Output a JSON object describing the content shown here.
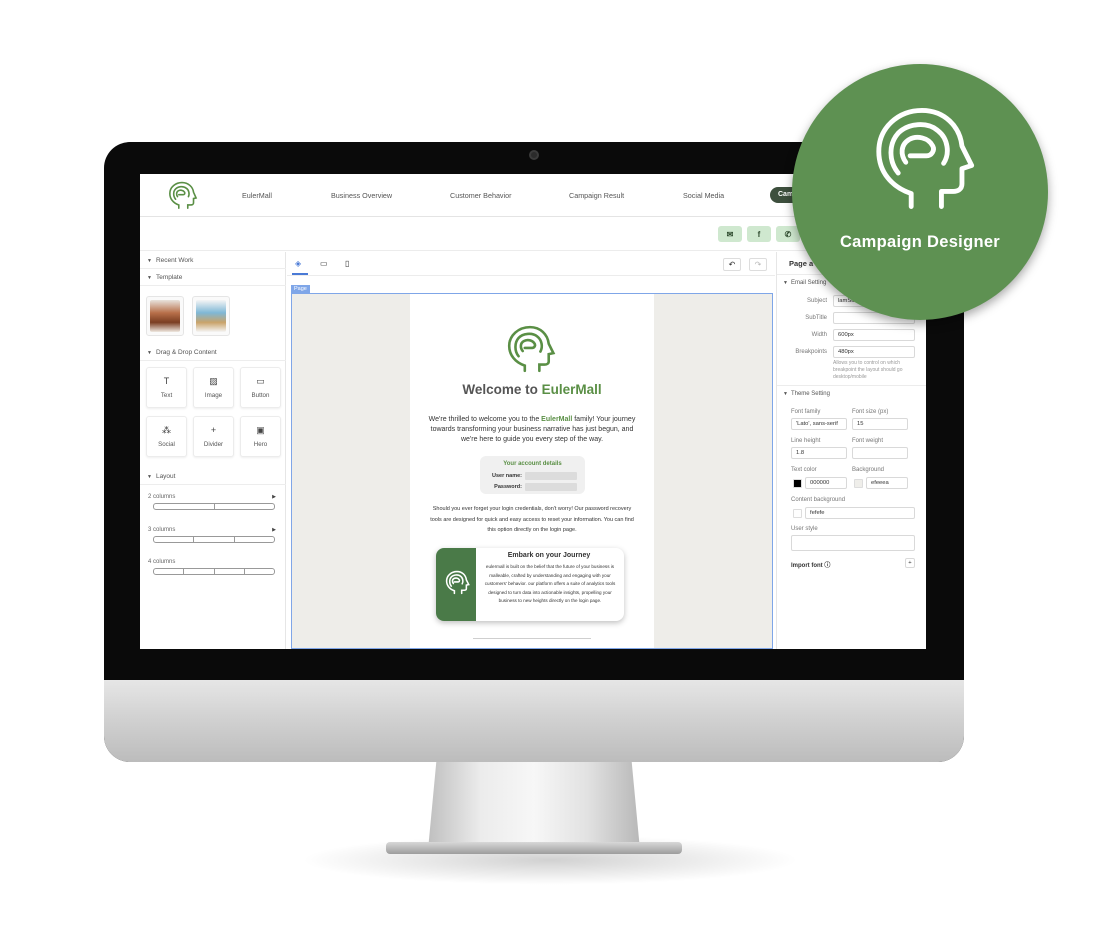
{
  "badge": {
    "label": "Campaign Designer"
  },
  "nav": {
    "items": [
      "EulerMall",
      "Business Overview",
      "Customer Behavior",
      "Campaign Result",
      "Social Media"
    ],
    "active_label": "Cam"
  },
  "share_buttons": [
    "mail-icon",
    "facebook-icon",
    "whatsapp-icon"
  ],
  "left_panel": {
    "recent_work": "Recent Work",
    "template": "Template",
    "drag_drop": "Drag & Drop Content",
    "tools": [
      {
        "label": "Text",
        "icon": "text-icon"
      },
      {
        "label": "Image",
        "icon": "image-icon"
      },
      {
        "label": "Button",
        "icon": "button-icon"
      },
      {
        "label": "Social",
        "icon": "social-icon"
      },
      {
        "label": "Divider",
        "icon": "divider-icon"
      },
      {
        "label": "Hero",
        "icon": "hero-icon"
      }
    ],
    "layout": "Layout",
    "layouts": [
      "2 columns",
      "3 columns",
      "4 columns"
    ]
  },
  "canvas": {
    "page_tag": "Page",
    "email": {
      "welcome_prefix": "Welcome to ",
      "welcome_brand": "EulerMall",
      "intro_pre": "We're thrilled to welcome you to the ",
      "intro_brand": "EulerMall",
      "intro_post": " family! Your journey towards transforming your business narrative has just begun, and we're here to guide you every step of the way.",
      "account_title": "Your account details",
      "username_label": "User name:",
      "password_label": "Password:",
      "recovery": "Should you ever forget your login credentials, don't worry! Our password recovery tools are designed for quick and easy access to reset your information. You can find this option directly on the login page.",
      "journey_title": "Embark on your Journey",
      "journey_body": "eulermall is built on the belief that the future of your business is malleable, crafted by understanding and engaging with your customers' behavior. our platform offers a suite of analytics tools designed to turn data into actionable insights, propelling your business to new heights directly on the login page."
    }
  },
  "right_panel": {
    "title": "Page a",
    "email_setting": "Email Setting",
    "subject_label": "Subject",
    "subject_value": "lamSu",
    "subtitle_label": "SubTitle",
    "subtitle_value": "",
    "width_label": "Width",
    "width_value": "600px",
    "breakpoints_label": "Breakpoints",
    "breakpoints_value": "480px",
    "breakpoints_help": "Allows you to control on which breakpoint the layout should go desktop/mobile",
    "theme_setting": "Theme Setting",
    "font_family_label": "Font family",
    "font_family_value": "'Lato', sans-serif",
    "font_size_label": "Font size (px)",
    "font_size_value": "15",
    "line_height_label": "Line height",
    "line_height_value": "1.8",
    "font_weight_label": "Font weight",
    "font_weight_value": "",
    "text_color_label": "Text color",
    "text_color_value": "000000",
    "background_label": "Background",
    "background_value": "efeeea",
    "content_bg_label": "Content background",
    "content_bg_value": "fefefe",
    "user_style_label": "User style",
    "import_font_label": "Import font"
  },
  "colors": {
    "brand_green": "#5a8f45",
    "badge_green": "#5e9152",
    "text_color": "#000000",
    "background": "#efeeea",
    "content_background": "#fefefe"
  }
}
